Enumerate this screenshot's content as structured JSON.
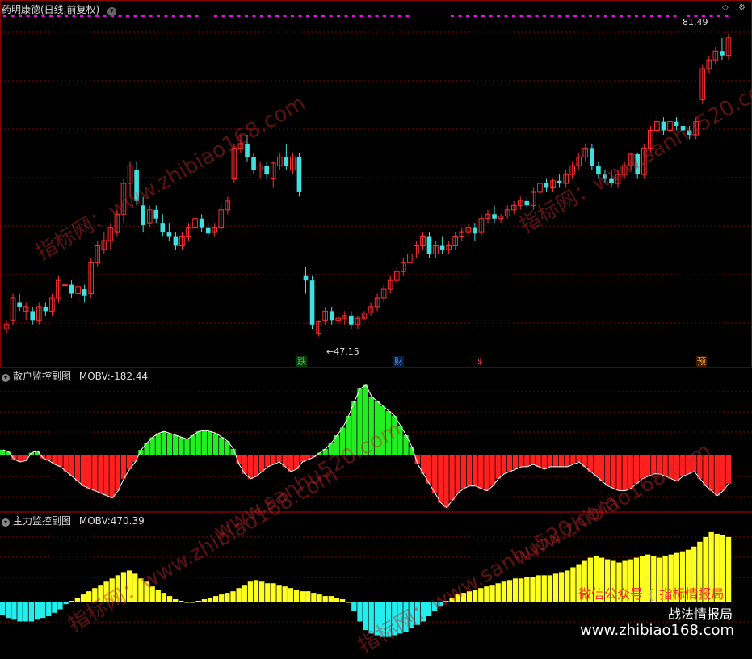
{
  "header": {
    "title": "药明康德(日线,前复权)",
    "dropdown_icon": "chevron-down-icon"
  },
  "main_chart": {
    "high_label": "81.49",
    "low_label": "47.15",
    "markers": [
      {
        "text": "跌",
        "color": "#2ecc40",
        "bg": "#0a3a0a"
      },
      {
        "text": "财",
        "color": "#3aa0ff",
        "bg": "#0a1a3a"
      },
      {
        "text": "$",
        "color": "#ff3030",
        "bg": "#000000"
      },
      {
        "text": "预",
        "color": "#ffaa33",
        "bg": "#3a1a00"
      }
    ],
    "candles": [
      [
        48,
        49,
        47.5,
        48.5
      ],
      [
        49,
        52,
        48.5,
        51.5
      ],
      [
        51,
        52,
        50,
        50.5
      ],
      [
        50,
        51,
        49,
        50.5
      ],
      [
        50,
        50.5,
        48.5,
        49
      ],
      [
        49,
        51,
        48.5,
        50.5
      ],
      [
        50.5,
        51,
        49.5,
        50
      ],
      [
        50,
        52,
        49.5,
        51.5
      ],
      [
        51.5,
        54,
        51,
        53.5
      ],
      [
        53,
        54.5,
        52,
        53
      ],
      [
        53,
        53.5,
        51.5,
        52
      ],
      [
        52,
        53,
        51,
        52.8
      ],
      [
        52.5,
        53,
        51,
        51.8
      ],
      [
        52,
        56,
        51.5,
        55.5
      ],
      [
        55.5,
        58,
        55,
        57.5
      ],
      [
        57,
        59,
        56.5,
        58
      ],
      [
        58,
        60,
        57,
        59.5
      ],
      [
        59,
        61.5,
        58.5,
        61
      ],
      [
        61,
        65,
        60,
        64.5
      ],
      [
        64.5,
        67,
        63,
        66.5
      ],
      [
        66,
        67,
        62,
        62.5
      ],
      [
        62,
        63,
        59,
        59.8
      ],
      [
        60,
        62,
        59.5,
        61.5
      ],
      [
        61.5,
        62,
        60,
        60.5
      ],
      [
        60,
        61,
        58.5,
        59
      ],
      [
        59,
        60,
        58,
        58.5
      ],
      [
        58.5,
        59,
        57,
        57.5
      ],
      [
        57.5,
        59,
        57,
        58.5
      ],
      [
        58.5,
        60,
        58,
        59.5
      ],
      [
        59.5,
        61,
        59,
        60.5
      ],
      [
        60.5,
        61,
        59,
        59.5
      ],
      [
        59.5,
        60,
        58.5,
        58.8
      ],
      [
        59,
        60,
        58.5,
        59.5
      ],
      [
        59.5,
        62,
        59,
        61.5
      ],
      [
        61.5,
        63,
        61,
        62.5
      ],
      [
        65,
        69,
        64.5,
        68.5
      ],
      [
        68.5,
        70,
        68,
        69
      ],
      [
        69,
        70,
        67,
        67.5
      ],
      [
        67.5,
        68,
        65.5,
        66
      ],
      [
        66,
        67,
        65,
        66.5
      ],
      [
        66.5,
        67,
        65,
        65.5
      ],
      [
        65,
        67,
        64,
        66.8
      ],
      [
        66.5,
        68,
        66,
        67.5
      ],
      [
        67.5,
        69,
        66,
        66.5
      ],
      [
        66,
        68,
        65.5,
        67.5
      ],
      [
        67.5,
        68,
        63,
        63.5
      ],
      [
        54,
        55,
        52,
        53.5
      ],
      [
        53.5,
        54,
        48,
        48.5
      ],
      [
        47.5,
        49,
        47.15,
        48.8
      ],
      [
        49,
        50.5,
        48.5,
        50
      ],
      [
        50,
        50.5,
        48.5,
        49
      ],
      [
        49,
        49.5,
        48.5,
        49.2
      ],
      [
        49.2,
        50,
        48.5,
        49.5
      ],
      [
        49.5,
        50,
        48,
        48.5
      ],
      [
        48.5,
        49.5,
        48,
        49.2
      ],
      [
        49.2,
        50,
        49,
        49.8
      ],
      [
        49.8,
        51,
        49.5,
        50.5
      ],
      [
        50.5,
        52,
        50,
        51.5
      ],
      [
        51.5,
        53,
        51,
        52.5
      ],
      [
        52.5,
        54,
        52,
        53.5
      ],
      [
        53.5,
        55,
        53,
        54.5
      ],
      [
        54.5,
        56,
        54,
        55.5
      ],
      [
        55.5,
        57,
        55,
        56.5
      ],
      [
        56.5,
        58,
        56,
        57.5
      ],
      [
        57.5,
        59,
        57,
        58.5
      ],
      [
        58.5,
        59,
        56,
        56.5
      ],
      [
        56.5,
        58,
        56,
        57.5
      ],
      [
        57.5,
        58.5,
        56.5,
        57
      ],
      [
        57,
        58,
        56.5,
        57.5
      ],
      [
        57.5,
        59,
        57,
        58.5
      ],
      [
        58.5,
        59.5,
        58,
        59
      ],
      [
        59,
        60,
        58.5,
        59.5
      ],
      [
        59.5,
        60,
        58,
        58.8
      ],
      [
        59,
        61,
        58.5,
        60.5
      ],
      [
        60.5,
        61.5,
        60,
        61
      ],
      [
        61,
        62,
        60,
        60.5
      ],
      [
        60.5,
        61,
        60,
        60.8
      ],
      [
        60.8,
        62,
        60.5,
        61.5
      ],
      [
        61.5,
        62.5,
        61,
        62
      ],
      [
        62,
        63,
        61.5,
        62.5
      ],
      [
        62.5,
        63,
        61.5,
        62
      ],
      [
        62,
        64,
        61.5,
        63.5
      ],
      [
        63.5,
        65,
        63,
        64.5
      ],
      [
        64.5,
        65,
        63.5,
        64
      ],
      [
        64,
        65,
        63.5,
        64.8
      ],
      [
        64.8,
        65.5,
        64,
        64.5
      ],
      [
        64.5,
        66,
        64,
        65.5
      ],
      [
        65.5,
        67,
        65,
        66.5
      ],
      [
        66.5,
        68,
        66,
        67.5
      ],
      [
        67.5,
        69,
        67,
        68.5
      ],
      [
        68.5,
        69,
        66,
        66.5
      ],
      [
        66.5,
        67,
        65,
        65.5
      ],
      [
        65.5,
        66,
        64.5,
        65
      ],
      [
        65,
        66,
        64,
        64.5
      ],
      [
        64.5,
        66,
        64,
        65.5
      ],
      [
        65.5,
        67,
        65,
        66.5
      ],
      [
        66.5,
        68,
        66,
        67.8
      ],
      [
        67.8,
        68,
        65,
        65.5
      ],
      [
        65.5,
        69,
        65,
        68.5
      ],
      [
        68.5,
        71,
        68,
        70.5
      ],
      [
        70.5,
        72,
        70,
        71.5
      ],
      [
        71.5,
        72,
        70,
        70.5
      ],
      [
        70.5,
        72,
        70,
        71.5
      ],
      [
        71.5,
        72,
        70.5,
        71
      ],
      [
        71,
        72,
        70,
        70.5
      ],
      [
        70.5,
        71,
        69.5,
        70
      ],
      [
        70,
        72,
        69.5,
        71.5
      ],
      [
        74,
        78,
        73.5,
        77.5
      ],
      [
        77.5,
        79,
        77,
        78.5
      ],
      [
        78.5,
        80,
        78,
        79.5
      ],
      [
        79.5,
        81,
        78.5,
        79
      ],
      [
        79,
        81.49,
        78.5,
        81
      ]
    ],
    "price_min": 45,
    "price_max": 83
  },
  "panel1": {
    "title": "散户监控副图",
    "indicator": "MOBV:",
    "value": "-182.44",
    "bars": [
      5,
      3,
      -4,
      -6,
      -5,
      2,
      4,
      -3,
      -5,
      -8,
      -10,
      -14,
      -18,
      -22,
      -26,
      -28,
      -30,
      -32,
      -34,
      -36,
      -30,
      -20,
      -12,
      -6,
      5,
      12,
      18,
      22,
      24,
      22,
      20,
      18,
      16,
      20,
      24,
      25,
      24,
      22,
      18,
      14,
      6,
      -8,
      -16,
      -20,
      -18,
      -14,
      -10,
      -8,
      -6,
      -10,
      -14,
      -12,
      -6,
      -4,
      -2,
      2,
      6,
      12,
      20,
      28,
      40,
      55,
      68,
      72,
      60,
      55,
      50,
      45,
      40,
      30,
      20,
      8,
      -8,
      -16,
      -24,
      -32,
      -40,
      -44,
      -38,
      -32,
      -28,
      -26,
      -26,
      -28,
      -30,
      -26,
      -20,
      -16,
      -14,
      -12,
      -10,
      -10,
      -8,
      -10,
      -12,
      -10,
      -10,
      -10,
      -10,
      -8,
      -6,
      -10,
      -14,
      -18,
      -22,
      -26,
      -28,
      -30,
      -30,
      -28,
      -24,
      -20,
      -18,
      -16,
      -16,
      -18,
      -20,
      -22,
      -18,
      -16,
      -14,
      -20,
      -26,
      -30,
      -34,
      -30,
      -24
    ],
    "bar_min": -45,
    "bar_max": 75
  },
  "panel2": {
    "title": "主力监控副图",
    "indicator": "MOBV:",
    "value": "470.39",
    "bars": [
      -15,
      -18,
      -20,
      -22,
      -22,
      -22,
      -20,
      -18,
      -16,
      -12,
      -8,
      -2,
      2,
      6,
      10,
      14,
      18,
      22,
      26,
      30,
      34,
      38,
      40,
      36,
      30,
      26,
      20,
      16,
      12,
      8,
      4,
      2,
      0,
      0,
      2,
      4,
      6,
      8,
      10,
      12,
      14,
      18,
      22,
      26,
      28,
      26,
      24,
      24,
      22,
      20,
      18,
      16,
      14,
      14,
      12,
      10,
      8,
      8,
      6,
      4,
      0,
      -10,
      -22,
      -32,
      -36,
      -38,
      -40,
      -40,
      -38,
      -36,
      -34,
      -30,
      -26,
      -22,
      -16,
      -10,
      -4,
      2,
      6,
      10,
      12,
      14,
      16,
      18,
      20,
      22,
      24,
      26,
      28,
      30,
      30,
      32,
      32,
      34,
      34,
      34,
      36,
      38,
      40,
      44,
      48,
      52,
      56,
      58,
      56,
      54,
      52,
      50,
      52,
      54,
      56,
      58,
      60,
      58,
      56,
      58,
      60,
      62,
      64,
      66,
      70,
      76,
      82,
      88,
      86,
      84,
      82
    ],
    "bar_min": -45,
    "bar_max": 95
  },
  "brand": {
    "line1_left": "微信公众号",
    "line1_right": "指标情报局",
    "line2": "战法情报局",
    "url": "www.zhibiao168.com"
  },
  "watermarks": [
    "www.zhibiao168.com",
    "指标网：www.sanhu520.com",
    "www.sanhu520.com",
    "指标网：www.zhibiao168.com"
  ],
  "colors": {
    "up": "#ff3030",
    "down": "#40e0e0",
    "mobv_pos": "#22ee22",
    "mobv_neg": "#ff2020",
    "main_pos": "#ffff22",
    "main_neg": "#22eeee",
    "grid": "#8a0000",
    "dots": "#ff00ff"
  }
}
